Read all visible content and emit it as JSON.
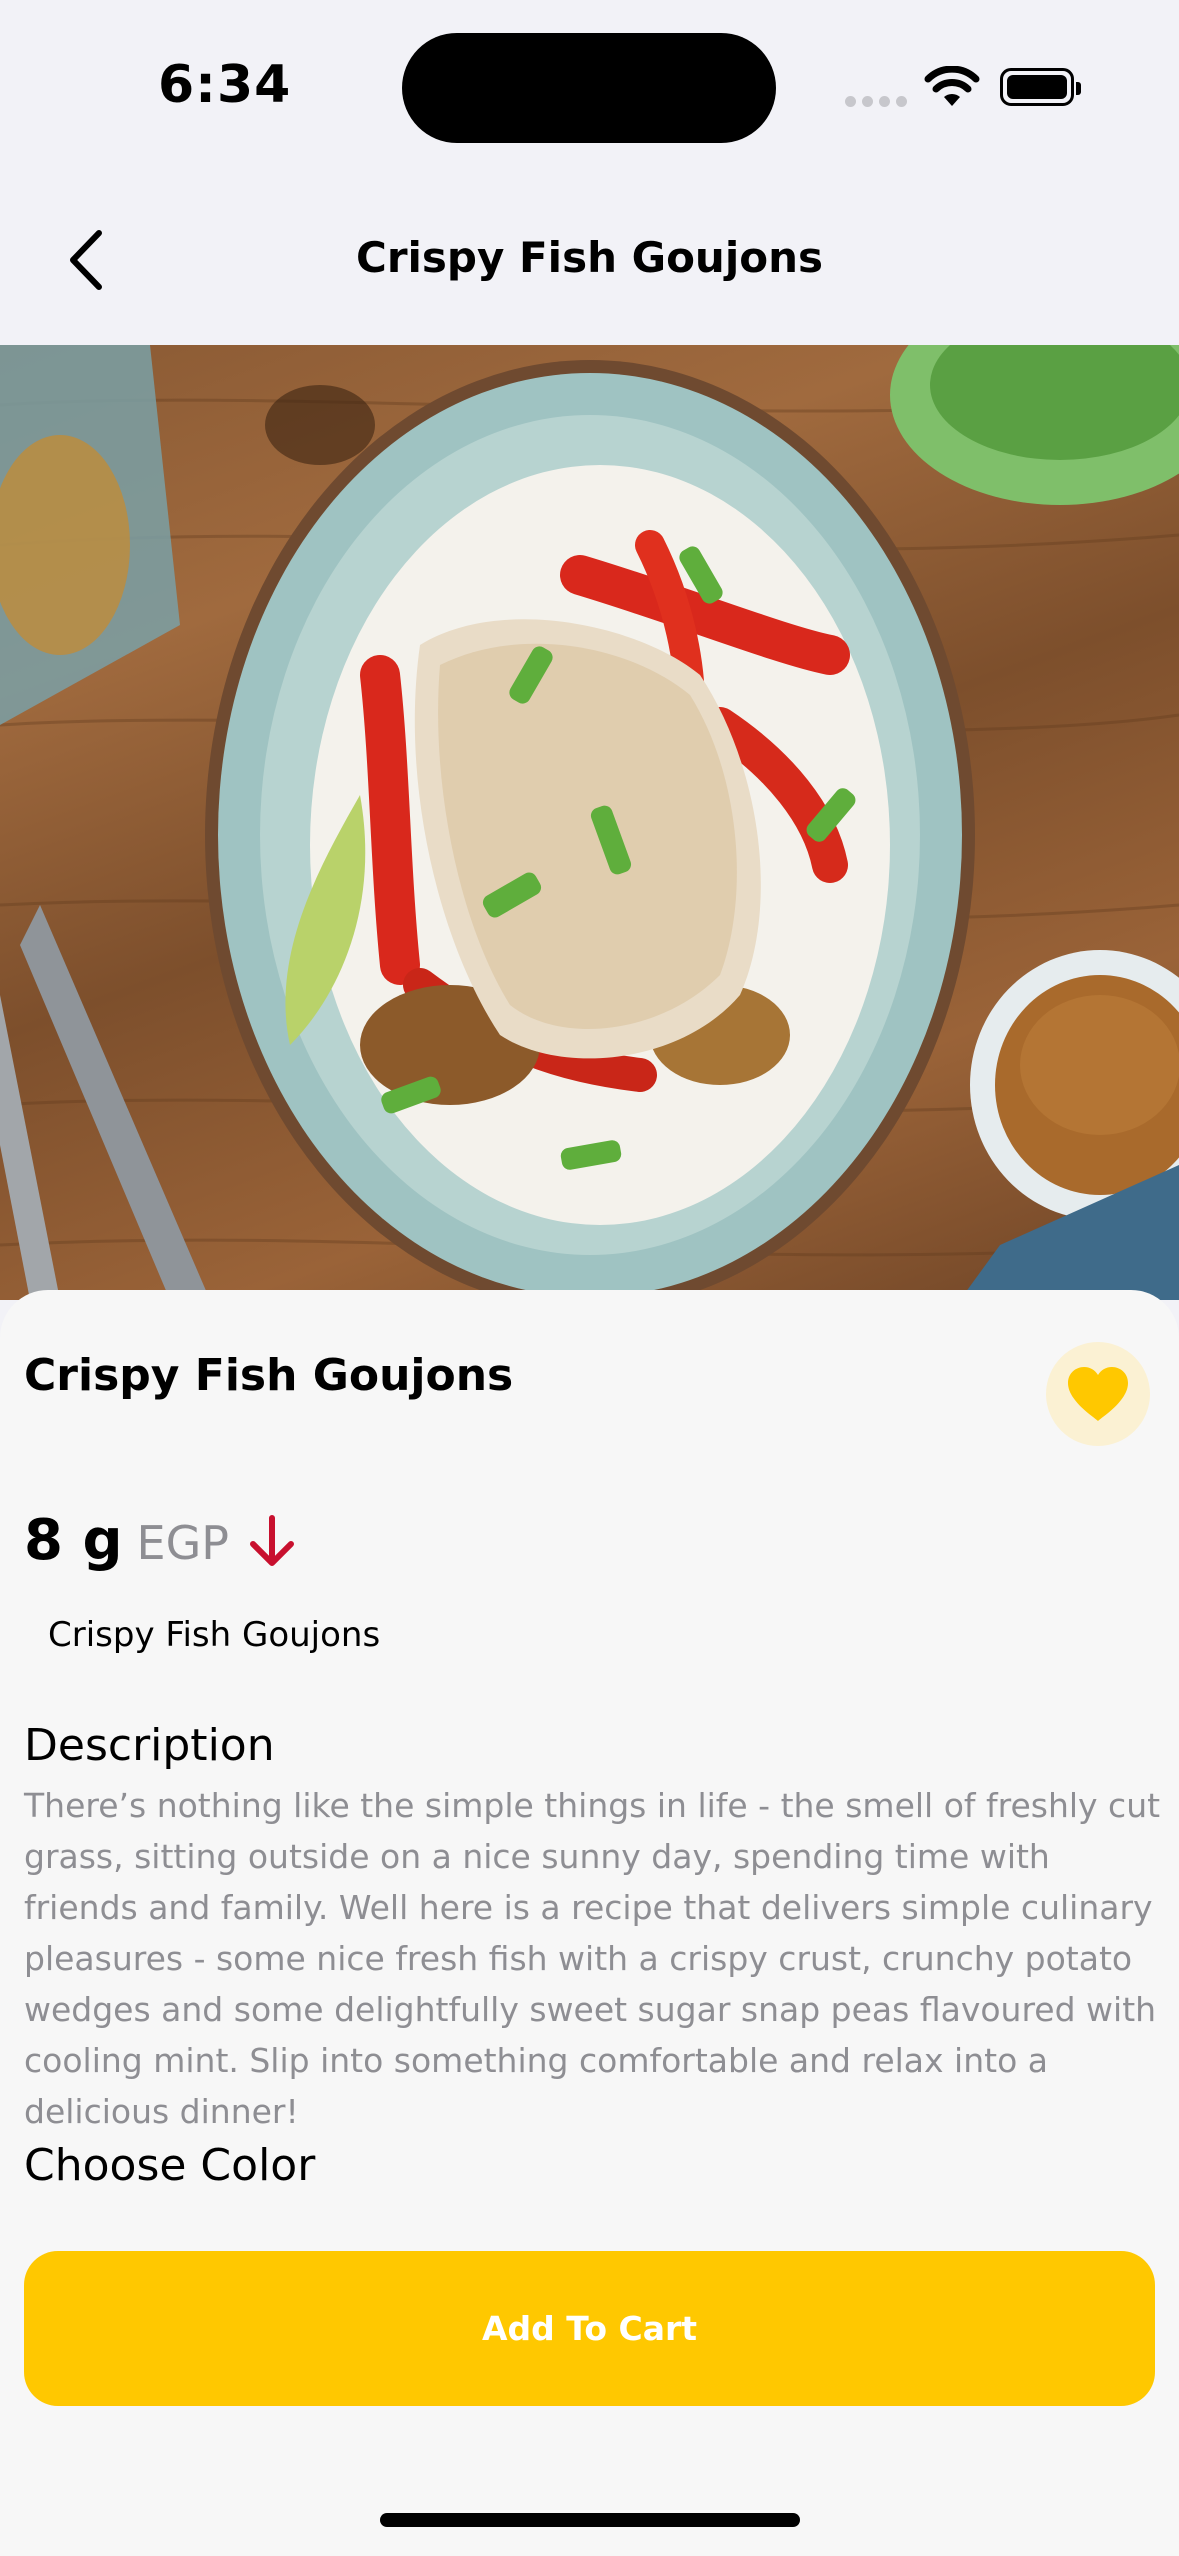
{
  "status_bar": {
    "time": "6:34"
  },
  "nav": {
    "title": "Crispy Fish Goujons",
    "back_icon": "chevron-left-icon"
  },
  "hero": {
    "image_alt": "Plate of crispy fish fillet on white rice with red peppers, spring onions and lime"
  },
  "product": {
    "title": "Crispy Fish Goujons",
    "favorite_icon": "heart-icon",
    "favorite_color": "#ffc800",
    "price_value": "8 g",
    "price_currency": "EGP",
    "price_trend_icon": "arrow-down-icon",
    "price_trend_color": "#c8102e",
    "subtitle": "Crispy Fish Goujons",
    "description_heading": "Description",
    "description": "There’s nothing like the simple things in life - the smell of freshly cut grass, sitting outside on a nice sunny day, spending time with friends and family. Well here is a recipe that delivers simple culinary pleasures - some nice fresh fish with a crispy crust, crunchy potato wedges and some delightfully sweet sugar snap peas flavoured with cooling mint. Slip into something comfortable and relax into a delicious dinner!",
    "choose_color_heading": "Choose Color"
  },
  "actions": {
    "add_to_cart_label": "Add To Cart",
    "accent_color": "#ffc800"
  }
}
